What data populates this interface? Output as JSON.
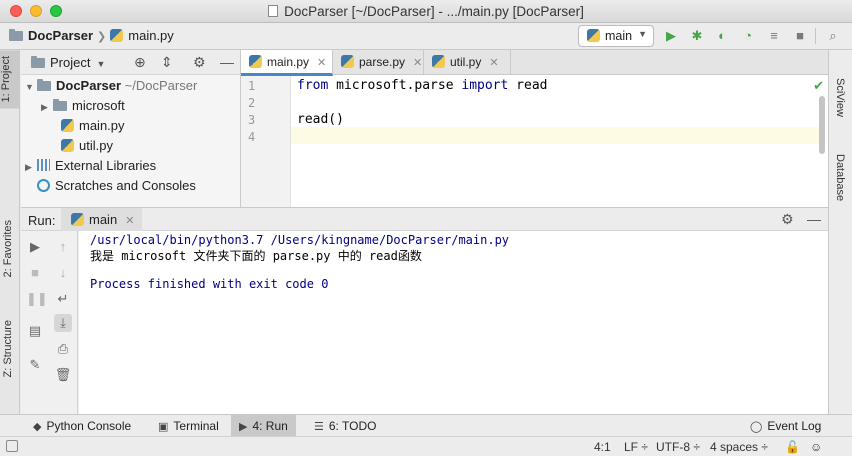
{
  "window": {
    "title": "DocParser [~/DocParser] - .../main.py [DocParser]"
  },
  "navbar": {
    "crumbs": [
      "DocParser",
      "main.py"
    ],
    "run_config": "main"
  },
  "left_strip": {
    "tabs": [
      "1: Project",
      "2: Favorites",
      "Z: Structure"
    ]
  },
  "right_strip": {
    "tabs": [
      "SciView",
      "Database"
    ]
  },
  "project": {
    "header_label": "Project",
    "root_name": "DocParser",
    "root_path": "~/DocParser",
    "items": [
      {
        "label": "microsoft",
        "icon": "folder-icon"
      },
      {
        "label": "main.py",
        "icon": "python-file-icon"
      },
      {
        "label": "util.py",
        "icon": "python-file-icon"
      },
      {
        "label": "External Libraries",
        "icon": "library-icon"
      },
      {
        "label": "Scratches and Consoles",
        "icon": "scratch-icon"
      }
    ]
  },
  "editor": {
    "tabs": [
      "main.py",
      "parse.py",
      "util.py"
    ],
    "active_tab": "main.py",
    "line_numbers": [
      "1",
      "2",
      "3",
      "4"
    ],
    "code": {
      "line1_kw_from": "from",
      "line1_module": " microsoft.parse ",
      "line1_kw_import": "import",
      "line1_name": " read",
      "line3": "read()"
    }
  },
  "run": {
    "label": "Run:",
    "tab": "main",
    "output": [
      "/usr/local/bin/python3.7 /Users/kingname/DocParser/main.py",
      "我是 microsoft 文件夹下面的 parse.py 中的 read函数",
      "",
      "Process finished with exit code 0"
    ]
  },
  "bottom_tabs": {
    "python_console": "Python Console",
    "terminal": "Terminal",
    "run": "4: Run",
    "todo": "6: TODO",
    "event_log": "Event Log"
  },
  "status": {
    "position": "4:1",
    "line_sep": "LF ÷",
    "encoding": "UTF-8 ÷",
    "indent": "4 spaces ÷"
  },
  "colors": {
    "accent": "#4a86c7",
    "run_green": "#47a447",
    "keyword_navy": "#000080"
  }
}
